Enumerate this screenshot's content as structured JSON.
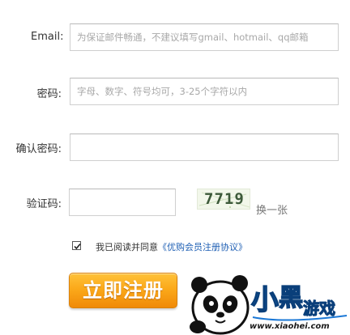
{
  "form": {
    "email_label": "Email:",
    "email_placeholder": "为保证邮件畅通，不建议填写gmail、hotmail、qq邮箱",
    "password_label": "密码:",
    "password_placeholder": "字母、数字、符号均可，3-25个字符以内",
    "confirm_label": "确认密码:",
    "confirm_placeholder": "",
    "captcha_label": "验证码:",
    "captcha_value": "",
    "captcha_code": "7719",
    "refresh_label": "换一张",
    "agree_checked": true,
    "agree_text": "我已阅读并同意",
    "agree_link": "《优购会员注册协议》",
    "submit_label": "立即注册"
  },
  "watermark": {
    "brand": "小黑游戏",
    "url": "www.xiaohei.com"
  },
  "colors": {
    "button_top": "#ffc23a",
    "button_bottom": "#f08a08",
    "link": "#1e5fb4",
    "brand_blue": "#1b78d6"
  }
}
